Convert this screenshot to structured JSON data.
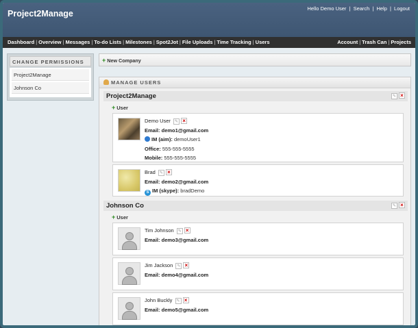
{
  "header": {
    "brand": "Project2Manage",
    "top_links": [
      "Hello Demo User",
      "Search",
      "Help",
      "Logout"
    ]
  },
  "nav": {
    "left": [
      "Dashboard",
      "Overview",
      "Messages",
      "To-do Lists",
      "Milestones",
      "Spot2Jot",
      "File Uploads",
      "Time Tracking",
      "Users"
    ],
    "right": [
      "Account",
      "Trash Can",
      "Projects"
    ]
  },
  "sidebar": {
    "title": "CHANGE PERMISSIONS",
    "items": [
      "Project2Manage",
      "Johnson Co"
    ]
  },
  "toolbar": {
    "new_company": "New Company"
  },
  "panel": {
    "title": "MANAGE USERS",
    "add_user": "User",
    "companies": [
      {
        "name": "Project2Manage",
        "users": [
          {
            "name": "Demo User",
            "email_label": "Email:",
            "email": "demo1@gmail.com",
            "im_label": "IM (aim):",
            "im": "demoUser1",
            "office_label": "Office:",
            "office": "555-555-5555",
            "mobile_label": "Mobile:",
            "mobile": "555-555-5555"
          },
          {
            "name": "Brad",
            "email_label": "Email:",
            "email": "demo2@gmail.com",
            "im_label": "IM (skype):",
            "im": "bradDemo"
          }
        ]
      },
      {
        "name": "Johnson Co",
        "users": [
          {
            "name": "Tim Johnson",
            "email_label": "Email:",
            "email": "demo3@gmail.com"
          },
          {
            "name": "Jim Jackson",
            "email_label": "Email:",
            "email": "demo4@gmail.com"
          },
          {
            "name": "John Buckly",
            "email_label": "Email:",
            "email": "demo5@gmail.com"
          }
        ]
      }
    ]
  },
  "colors": {
    "header": "#4a6280",
    "navbar": "#303030",
    "accent_green": "#2b8a1f",
    "delete_red": "#cc0000"
  }
}
